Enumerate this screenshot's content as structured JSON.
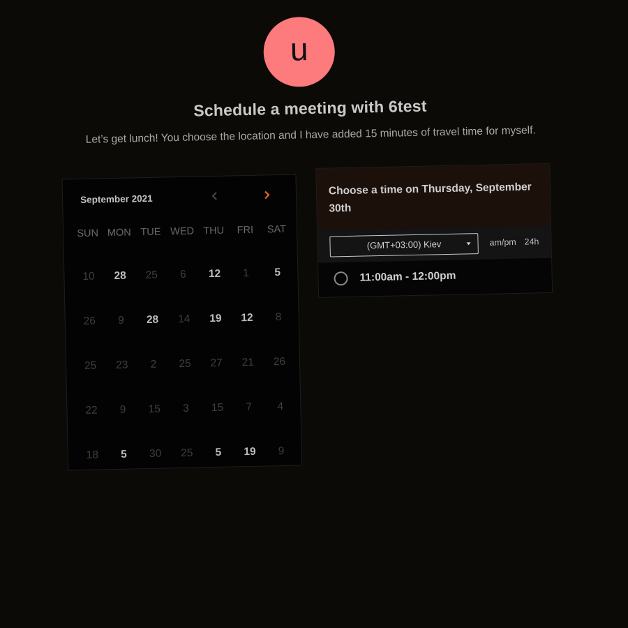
{
  "host": {
    "avatar_letter": "u",
    "avatar_color": "#fd7a7d"
  },
  "title": "Schedule a meeting with 6test",
  "description": "Let’s get lunch! You choose the location and I have added 15 minutes of travel time for myself.",
  "calendar": {
    "month_label": "September 2021",
    "prev_icon": "chevron-left-icon",
    "next_icon": "chevron-right-icon",
    "accent_color": "#e8642c",
    "weekdays": [
      "SUN",
      "MON",
      "TUE",
      "WED",
      "THU",
      "FRI",
      "SAT"
    ],
    "weeks": [
      [
        {
          "d": "10",
          "a": false
        },
        {
          "d": "28",
          "a": true
        },
        {
          "d": "25",
          "a": false
        },
        {
          "d": "6",
          "a": false
        },
        {
          "d": "12",
          "a": true
        },
        {
          "d": "1",
          "a": false
        },
        {
          "d": "5",
          "a": true
        }
      ],
      [
        {
          "d": "26",
          "a": false
        },
        {
          "d": "9",
          "a": false
        },
        {
          "d": "28",
          "a": true
        },
        {
          "d": "14",
          "a": false
        },
        {
          "d": "19",
          "a": true
        },
        {
          "d": "12",
          "a": true
        },
        {
          "d": "8",
          "a": false
        }
      ],
      [
        {
          "d": "25",
          "a": false
        },
        {
          "d": "23",
          "a": false
        },
        {
          "d": "2",
          "a": false
        },
        {
          "d": "25",
          "a": false
        },
        {
          "d": "27",
          "a": false
        },
        {
          "d": "21",
          "a": false
        },
        {
          "d": "26",
          "a": false
        }
      ],
      [
        {
          "d": "22",
          "a": false
        },
        {
          "d": "9",
          "a": false
        },
        {
          "d": "15",
          "a": false
        },
        {
          "d": "3",
          "a": false
        },
        {
          "d": "15",
          "a": false
        },
        {
          "d": "7",
          "a": false
        },
        {
          "d": "4",
          "a": false
        }
      ],
      [
        {
          "d": "18",
          "a": false
        },
        {
          "d": "5",
          "a": true
        },
        {
          "d": "30",
          "a": false
        },
        {
          "d": "25",
          "a": false
        },
        {
          "d": "5",
          "a": true
        },
        {
          "d": "19",
          "a": true
        },
        {
          "d": "9",
          "a": false
        }
      ]
    ]
  },
  "timepicker": {
    "heading": "Choose a time on Thursday, September 30th",
    "timezone": "(GMT+03:00) Kiev",
    "format_ampm": "am/pm",
    "format_24h": "24h",
    "slots": [
      {
        "label": "11:00am - 12:00pm"
      }
    ]
  }
}
